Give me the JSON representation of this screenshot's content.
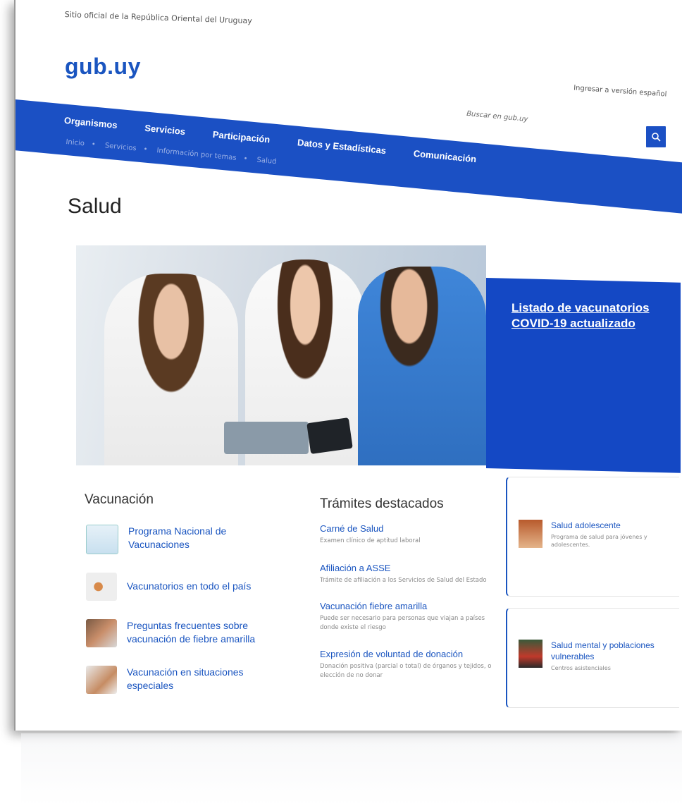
{
  "header": {
    "official_text": "Sitio oficial de la República Oriental del Uruguay",
    "logo": "gub.uy",
    "language_link": "Ingresar a versión español"
  },
  "nav": {
    "items": [
      "Organismos",
      "Servicios",
      "Participación",
      "Datos y Estadísticas",
      "Comunicación"
    ],
    "search_placeholder": "Buscar en gub.uy",
    "search_icon": "search-icon"
  },
  "breadcrumb": [
    "Inicio",
    "Servicios",
    "Información por temas",
    "Salud"
  ],
  "page": {
    "title": "Salud"
  },
  "hero": {
    "link": "Listado de vacunatorios COVID-19 actualizado",
    "accent": "#1448c4"
  },
  "vacunacion": {
    "heading": "Vacunación",
    "items": [
      {
        "label": "Programa Nacional de Vacunaciones"
      },
      {
        "label": "Vacunatorios en todo el país"
      },
      {
        "label": "Preguntas frecuentes sobre vacunación de fiebre amarilla"
      },
      {
        "label": "Vacunación en situaciones especiales"
      }
    ]
  },
  "tramites": {
    "heading": "Trámites destacados",
    "items": [
      {
        "title": "Carné de Salud",
        "desc": "Examen clínico de aptitud laboral"
      },
      {
        "title": "Afiliación a ASSE",
        "desc": "Trámite de afiliación a los Servicios de Salud del Estado"
      },
      {
        "title": "Vacunación fiebre amarilla",
        "desc": "Puede ser necesario para personas que viajan a países donde existe el riesgo"
      },
      {
        "title": "Expresión de voluntad de donación",
        "desc": "Donación positiva (parcial o total) de órganos y tejidos, o elección de no donar"
      }
    ]
  },
  "side": {
    "items": [
      {
        "title": "Salud adolescente",
        "desc": "Programa de salud para jóvenes y adolescentes."
      },
      {
        "title": "Salud mental y poblaciones vulnerables",
        "desc": "Centros asistenciales"
      }
    ]
  },
  "colors": {
    "brand": "#1b50c4",
    "link": "#1a55c0"
  }
}
